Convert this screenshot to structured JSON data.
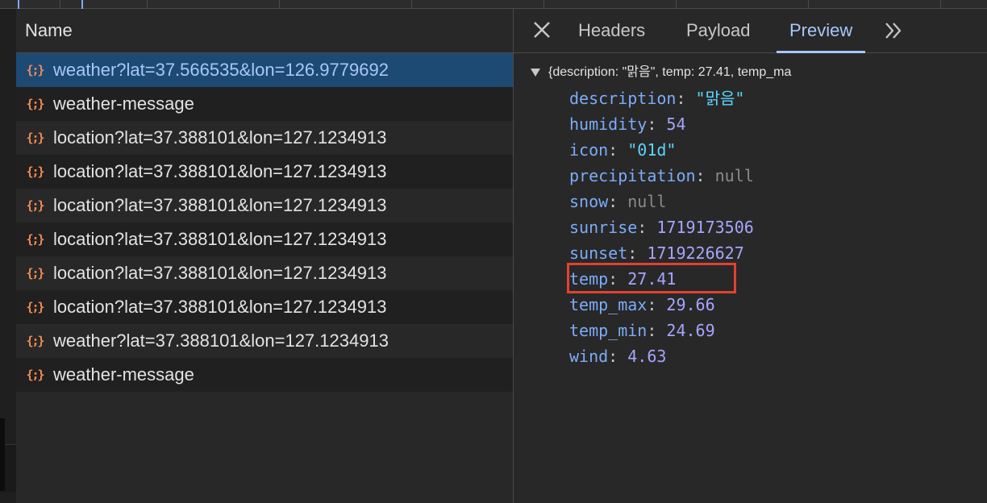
{
  "network": {
    "column_header": "Name",
    "requests": [
      {
        "name": "weather?lat=37.566535&lon=126.9779692",
        "icon": "json-icon",
        "selected": true
      },
      {
        "name": "weather-message",
        "icon": "json-icon"
      },
      {
        "name": "location?lat=37.388101&lon=127.1234913",
        "icon": "json-icon"
      },
      {
        "name": "location?lat=37.388101&lon=127.1234913",
        "icon": "json-icon"
      },
      {
        "name": "location?lat=37.388101&lon=127.1234913",
        "icon": "json-icon"
      },
      {
        "name": "location?lat=37.388101&lon=127.1234913",
        "icon": "json-icon"
      },
      {
        "name": "location?lat=37.388101&lon=127.1234913",
        "icon": "json-icon"
      },
      {
        "name": "location?lat=37.388101&lon=127.1234913",
        "icon": "json-icon"
      },
      {
        "name": "weather?lat=37.388101&lon=127.1234913",
        "icon": "json-icon"
      },
      {
        "name": "weather-message",
        "icon": "json-icon"
      }
    ],
    "icon_glyph": "{;}"
  },
  "detail": {
    "tabs": [
      {
        "label": "Headers"
      },
      {
        "label": "Payload"
      },
      {
        "label": "Preview",
        "active": true
      }
    ],
    "close_icon": "close-icon",
    "more_icon": "chevron-double-right-icon",
    "summary": "{description: \"맑음\", temp: 27.41, temp_ma",
    "fields": [
      {
        "key": "description",
        "value": "\"맑음\"",
        "type": "string"
      },
      {
        "key": "humidity",
        "value": "54",
        "type": "number"
      },
      {
        "key": "icon",
        "value": "\"01d\"",
        "type": "string"
      },
      {
        "key": "precipitation",
        "value": "null",
        "type": "null"
      },
      {
        "key": "snow",
        "value": "null",
        "type": "null"
      },
      {
        "key": "sunrise",
        "value": "1719173506",
        "type": "number"
      },
      {
        "key": "sunset",
        "value": "1719226627",
        "type": "number"
      },
      {
        "key": "temp",
        "value": "27.41",
        "type": "number",
        "highlighted": true
      },
      {
        "key": "temp_max",
        "value": "29.66",
        "type": "number"
      },
      {
        "key": "temp_min",
        "value": "24.69",
        "type": "number"
      },
      {
        "key": "wind",
        "value": "4.63",
        "type": "number"
      }
    ],
    "highlight_color": "#e2422f"
  },
  "colors": {
    "key": "#7cacf8",
    "string": "#5cd5fb",
    "number": "#a5a5ff",
    "null": "#8a8a8a",
    "selected_row": "#1d4a73",
    "accent": "#a8c7fa"
  }
}
